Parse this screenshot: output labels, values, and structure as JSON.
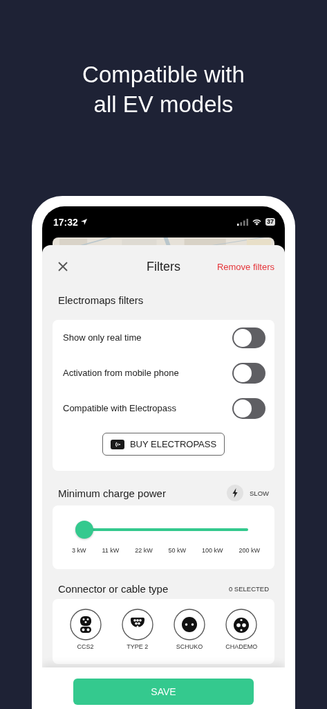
{
  "headline": "Compatible with all EV models",
  "status_bar": {
    "time": "17:32",
    "battery": "37"
  },
  "header": {
    "title": "Filters",
    "action": "Remove filters"
  },
  "electromaps_filters": {
    "title": "Electromaps filters",
    "toggles": [
      {
        "label": "Show only real time",
        "on": false
      },
      {
        "label": "Activation from mobile phone",
        "on": false
      },
      {
        "label": "Compatible with Electropass",
        "on": false
      }
    ],
    "button": "BUY ELECTROPASS"
  },
  "charge_power": {
    "title": "Minimum charge power",
    "badge": "SLOW",
    "slider": {
      "level": 0,
      "ticks": [
        "3 kW",
        "11 kW",
        "22 kW",
        "50 kW",
        "100 kW",
        "200 kW"
      ]
    }
  },
  "connectors": {
    "title": "Connector or cable type",
    "count": "0 SELECTED",
    "items": [
      {
        "label": "CCS2",
        "kind": "ccs2",
        "selected": false
      },
      {
        "label": "TYPE 2",
        "kind": "type2",
        "selected": false
      },
      {
        "label": "SCHUKO",
        "kind": "schuko",
        "selected": false
      },
      {
        "label": "CHADEMO",
        "kind": "chademo",
        "selected": false
      }
    ]
  },
  "save_button": "SAVE"
}
